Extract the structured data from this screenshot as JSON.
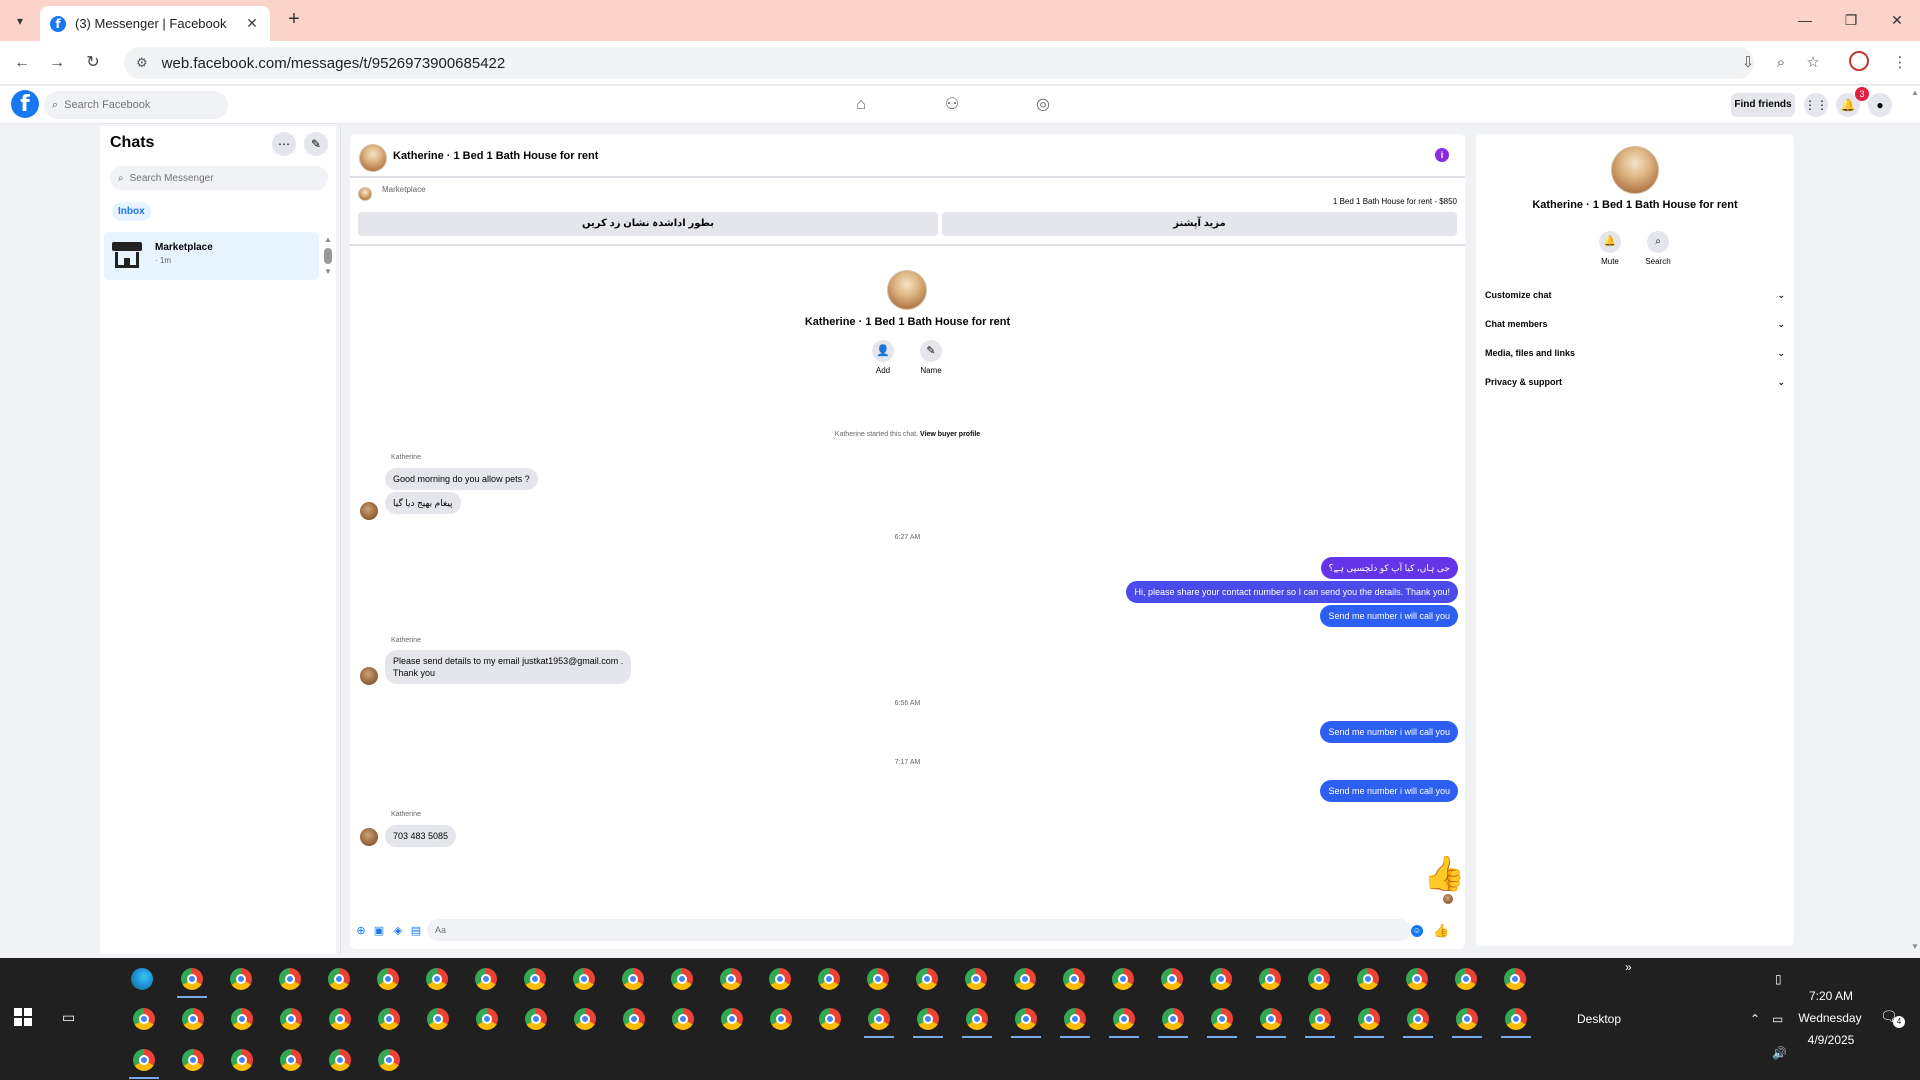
{
  "browser": {
    "tab_title": "(3) Messenger | Facebook",
    "url": "web.facebook.com/messages/t/9526973900685422"
  },
  "fb": {
    "search_placeholder": "Search Facebook",
    "find_friends": "Find friends",
    "notification_count": "3"
  },
  "chats": {
    "title": "Chats",
    "search_placeholder": "Search Messenger",
    "filter": "Inbox",
    "items": [
      {
        "name": "Marketplace",
        "sub": "· 1m"
      }
    ]
  },
  "conversation": {
    "title": "Katherine · 1 Bed 1 Bath House for rent",
    "marketplace_label": "Marketplace",
    "listing": "1 Bed 1 Bath House for rent - $850",
    "btn_mark_sold": "بطور اداشدہ نشان زد کریں",
    "btn_more_options": "مزید آپشنز",
    "intro_name": "Katherine · 1 Bed 1 Bath House for rent",
    "intro_add": "Add",
    "intro_name_btn": "Name",
    "started_text": "Katherine started this chat.",
    "buyer_profile_link": "View buyer profile",
    "compose_placeholder": "Aa",
    "messages": [
      {
        "sender": "Katherine",
        "text": "Good morning do you allow pets ?"
      },
      {
        "text": "پیغام بھیج دیا گیا"
      },
      {
        "time": "6:27 AM"
      },
      {
        "text": "جی ہاں، کیا آپ کو دلچسپی ہے؟"
      },
      {
        "text": "Hi, please share your contact number so I can send you the details. Thank you!"
      },
      {
        "text": "Send me number i will call you"
      },
      {
        "sender": "Katherine",
        "text": "Please send details to my email justkat1953@gmail.com .",
        "text2": "Thank you"
      },
      {
        "time": "6:56 AM"
      },
      {
        "text": "Send me number i will call you"
      },
      {
        "time": "7:17 AM"
      },
      {
        "text": "Send me number i will call you"
      },
      {
        "sender": "Katherine",
        "text": "703 483 5085"
      }
    ]
  },
  "info_panel": {
    "name": "Katherine · 1 Bed 1 Bath House for rent",
    "mute": "Mute",
    "search": "Search",
    "rows": [
      "Customize chat",
      "Chat members",
      "Media, files and links",
      "Privacy & support"
    ]
  },
  "taskbar": {
    "desktop_label": "Desktop",
    "time": "7:20 AM",
    "day": "Wednesday",
    "date": "4/9/2025",
    "notification_count": "4"
  },
  "colors": {
    "accent": "#1877f2",
    "out_bubble_purple": "#6435e8",
    "out_bubble_blue": "#2d5ff2",
    "tab_strip": "#fbd3c9"
  }
}
